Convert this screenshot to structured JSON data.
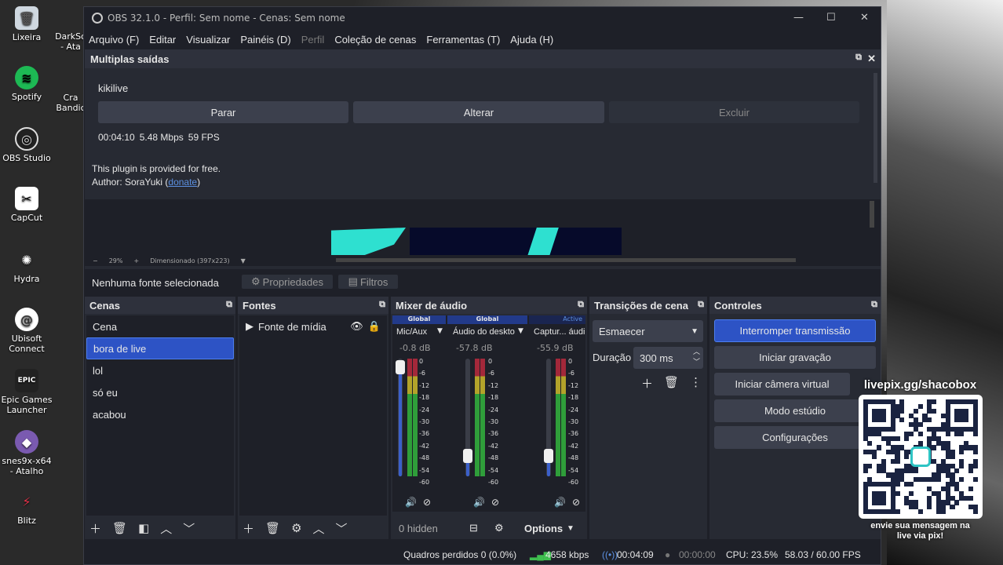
{
  "desktop": [
    {
      "label": "Lixeira",
      "icon": "recycle-bin-icon"
    },
    {
      "label": "Spotify",
      "icon": "spotify-icon"
    },
    {
      "label": "OBS Studio",
      "icon": "obs-icon"
    },
    {
      "label": "CapCut",
      "icon": "capcut-icon"
    },
    {
      "label": "Hydra",
      "icon": "hydra-icon"
    },
    {
      "label": "Ubisoft Connect",
      "icon": "ubisoft-icon"
    },
    {
      "label": "Epic Games Launcher",
      "icon": "epic-icon"
    },
    {
      "label": "snes9x-x64 - Atalho",
      "icon": "snes-icon"
    },
    {
      "label": "Blitz",
      "icon": "blitz-icon"
    }
  ],
  "desktop2": [
    {
      "label": "DarkSo - Ata"
    },
    {
      "label": "Cra Bandic"
    }
  ],
  "window": {
    "title": "OBS 32.1.0 - Perfil: Sem nome - Cenas: Sem nome"
  },
  "menu": [
    "Arquivo (F)",
    "Editar",
    "Visualizar",
    "Painéis (D)",
    "Perfil",
    "Coleção de cenas",
    "Ferramentas (T)",
    "Ajuda (H)"
  ],
  "multi": {
    "title": "Multiplas saídas",
    "name": "kikilive",
    "stop": "Parar",
    "change": "Alterar",
    "delete": "Excluir",
    "time": "00:04:10",
    "bitrate": "5.48 Mbps",
    "fps": "59 FPS",
    "plugin": "This plugin is provided for free.",
    "author_prefix": "Author: SoraYuki (",
    "donate": "donate",
    "author_suffix": ")"
  },
  "preview": {
    "zoom": "29%",
    "dim": "Dimensionado (397x223)"
  },
  "sourcebar": {
    "none": "Nenhuma fonte selecionada",
    "props": "Propriedades",
    "filters": "Filtros"
  },
  "scenes": {
    "title": "Cenas",
    "items": [
      "Cena",
      "bora de live",
      "lol",
      "só eu",
      "acabou"
    ],
    "selected": 1
  },
  "sources": {
    "title": "Fontes",
    "items": [
      "Fonte de mídia"
    ]
  },
  "mixer": {
    "title": "Mixer de áudio",
    "channels": [
      {
        "tag": "Global",
        "name": "Mic/Aux",
        "db": "-0.8 dB",
        "level": 0.93,
        "active": false
      },
      {
        "tag": "Global",
        "name": "Áudio do deskto",
        "db": "-57.8 dB",
        "level": 0.18,
        "active": false
      },
      {
        "tag": "Active",
        "name": "Captur... áudi",
        "db": "-55.9 dB",
        "level": 0.18,
        "active": true
      }
    ],
    "scale": [
      "0",
      "-6",
      "-12",
      "-18",
      "-24",
      "-30",
      "-36",
      "-42",
      "-48",
      "-54",
      "-60"
    ],
    "hidden": "0 hidden",
    "options": "Options"
  },
  "transitions": {
    "title": "Transições de cena",
    "selected": "Esmaecer",
    "duration_label": "Duração",
    "duration": "300 ms"
  },
  "controls": {
    "title": "Controles",
    "buttons": [
      "Interromper transmissão",
      "Iniciar gravação",
      "Iniciar câmera virtual",
      "Modo estúdio",
      "Configurações"
    ]
  },
  "status": {
    "frames": "Quadros perdidos 0 (0.0%)",
    "kbps": "4658 kbps",
    "live": "00:04:09",
    "rec": "00:00:00",
    "cpu": "CPU: 23.5%",
    "fps": "58.03 / 60.00 FPS"
  },
  "overlay": {
    "url": "livepix.gg/shacobox",
    "line1": "envie sua mensagem na",
    "line2": "live via pix!"
  },
  "colors": {
    "accent": "#2d53c5",
    "meter_green": "#2f9e3a",
    "meter_yellow": "#b3a32a",
    "meter_red": "#a3283a"
  }
}
